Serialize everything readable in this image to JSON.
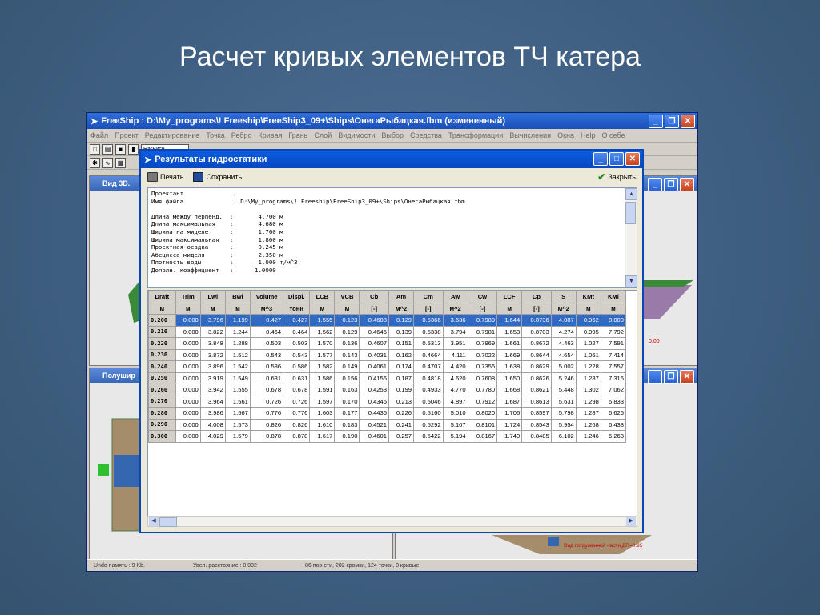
{
  "slide_title": "Расчет кривых элементов ТЧ катера",
  "app": {
    "title": "FreeShip  : D:\\My_programs\\! Freeship\\FreeShip3_09+\\Ships\\ОнегаРыбацкая.fbm (измененный)",
    "menu": [
      "Файл",
      "Проект",
      "Редактирование",
      "Точка",
      "Ребро",
      "Кривая",
      "Грань",
      "Слой",
      "Видимости",
      "Выбор",
      "Средства",
      "Трансформации",
      "Вычисления",
      "Окна",
      "Help",
      "О себе"
    ],
    "toolbar_combo": "Нагнисн",
    "pane_3d_title": "Вид 3D.",
    "pane_bottom_title": "Полушир",
    "status": {
      "undo": "Undo память : 9 Kb.",
      "dist": "Увел. расстояние : 0.002",
      "counts": "86 пов-сти, 202 кромки, 124 точки, 0 кривые"
    },
    "bottom_right_label": "Вид погруженной части ДП=0.95",
    "right_value": "0.00"
  },
  "dialog": {
    "title": "Результаты гидростатики",
    "print_label": "Печать",
    "save_label": "Сохранить",
    "close_label": "Закрыть",
    "info_lines": [
      "Проектант              :",
      "Имя файла              : D:\\My_programs\\! Freeship\\FreeShip3_09+\\Ships\\ОнегаРыбацкая.fbm",
      "",
      "Длина между перпенд.  :       4.700 м",
      "Длина максимальная    :       4.680 м",
      "Ширина на миделе      :       1.760 м",
      "Ширина максимальная   :       1.800 м",
      "Проектная осадка      :       0.245 м",
      "Абсцисса миделя       :       2.350 м",
      "Плотность воды        :       1.000 т/м^3",
      "Дополн. коэффициент   :      1.0000"
    ],
    "table": {
      "headers": [
        "Draft",
        "Trim",
        "Lwl",
        "Bwl",
        "Volume",
        "Displ.",
        "LCB",
        "VCB",
        "Cb",
        "Am",
        "Cm",
        "Aw",
        "Cw",
        "LCF",
        "Cp",
        "S",
        "KMt",
        "KMl"
      ],
      "units": [
        "м",
        "м",
        "м",
        "м",
        "м^3",
        "тонн",
        "м",
        "м",
        "[-]",
        "м^2",
        "[-]",
        "м^2",
        "[-]",
        "м",
        "[-]",
        "м^2",
        "м",
        "м"
      ],
      "rows": [
        [
          "0.200",
          "0.000",
          "3.796",
          "1.199",
          "0.427",
          "0.427",
          "1.555",
          "0.123",
          "0.4688",
          "0.129",
          "0.5366",
          "3.636",
          "0.7989",
          "1.644",
          "0.8736",
          "4.087",
          "0.962",
          "8.000"
        ],
        [
          "0.210",
          "0.000",
          "3.822",
          "1.244",
          "0.464",
          "0.464",
          "1.562",
          "0.129",
          "0.4646",
          "0.139",
          "0.5338",
          "3.794",
          "0.7981",
          "1.653",
          "0.8703",
          "4.274",
          "0.995",
          "7.792"
        ],
        [
          "0.220",
          "0.000",
          "3.848",
          "1.288",
          "0.503",
          "0.503",
          "1.570",
          "0.136",
          "0.4607",
          "0.151",
          "0.5313",
          "3.951",
          "0.7969",
          "1.661",
          "0.8672",
          "4.463",
          "1.027",
          "7.591"
        ],
        [
          "0.230",
          "0.000",
          "3.872",
          "1.512",
          "0.543",
          "0.543",
          "1.577",
          "0.143",
          "0.4031",
          "0.162",
          "0.4664",
          "4.111",
          "0.7022",
          "1.669",
          "0.8644",
          "4.654",
          "1.061",
          "7.414"
        ],
        [
          "0.240",
          "0.000",
          "3.896",
          "1.542",
          "0.586",
          "0.586",
          "1.582",
          "0.149",
          "0.4061",
          "0.174",
          "0.4707",
          "4.420",
          "0.7356",
          "1.638",
          "0.8629",
          "5.002",
          "1.228",
          "7.557"
        ],
        [
          "0.250",
          "0.000",
          "3.919",
          "1.549",
          "0.631",
          "0.631",
          "1.586",
          "0.156",
          "0.4156",
          "0.187",
          "0.4818",
          "4.620",
          "0.7608",
          "1.650",
          "0.8626",
          "5.246",
          "1.287",
          "7.316"
        ],
        [
          "0.260",
          "0.000",
          "3.942",
          "1.555",
          "0.678",
          "0.678",
          "1.591",
          "0.163",
          "0.4253",
          "0.199",
          "0.4933",
          "4.770",
          "0.7780",
          "1.668",
          "0.8621",
          "5.448",
          "1.302",
          "7.062"
        ],
        [
          "0.270",
          "0.000",
          "3.964",
          "1.561",
          "0.726",
          "0.726",
          "1.597",
          "0.170",
          "0.4346",
          "0.213",
          "0.5046",
          "4.897",
          "0.7912",
          "1.687",
          "0.8613",
          "5.631",
          "1.298",
          "6.833"
        ],
        [
          "0.280",
          "0.000",
          "3.986",
          "1.567",
          "0.776",
          "0.776",
          "1.603",
          "0.177",
          "0.4436",
          "0.226",
          "0.5160",
          "5.010",
          "0.8020",
          "1.706",
          "0.8597",
          "5.798",
          "1.287",
          "6.626"
        ],
        [
          "0.290",
          "0.000",
          "4.008",
          "1.573",
          "0.826",
          "0.826",
          "1.610",
          "0.183",
          "0.4521",
          "0.241",
          "0.5292",
          "5.107",
          "0.8101",
          "1.724",
          "0.8543",
          "5.954",
          "1.268",
          "6.438"
        ],
        [
          "0.300",
          "0.000",
          "4.029",
          "1.579",
          "0.878",
          "0.878",
          "1.617",
          "0.190",
          "0.4601",
          "0.257",
          "0.5422",
          "5.194",
          "0.8167",
          "1.740",
          "0.8485",
          "6.102",
          "1.246",
          "6.263"
        ]
      ]
    }
  }
}
